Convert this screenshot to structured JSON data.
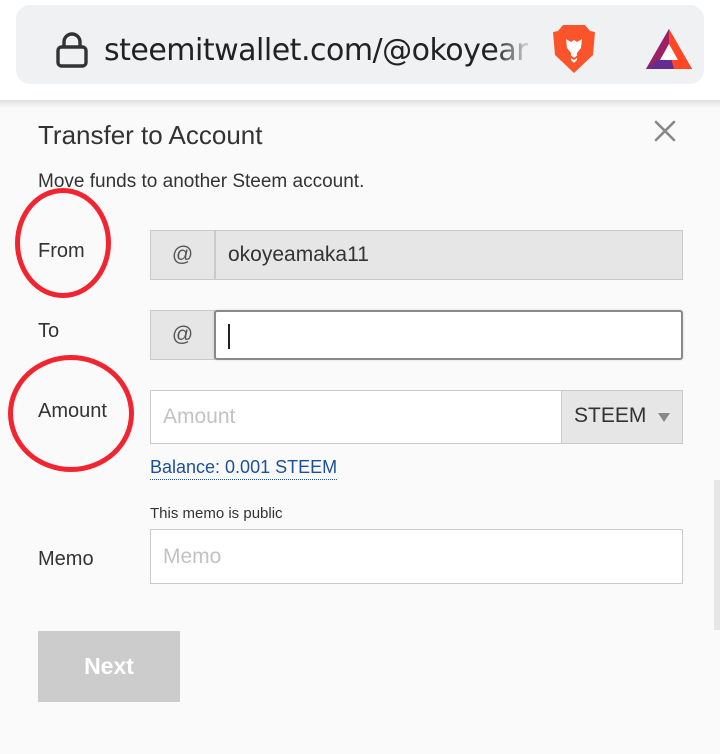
{
  "browser": {
    "url_display": "steemitwallet.com/@okoyeam",
    "icons": [
      "lock-icon",
      "brave-lion-icon",
      "bat-icon"
    ]
  },
  "dialog": {
    "title": "Transfer to Account",
    "subtitle": "Move funds to another Steem account.",
    "close_icon": "close-icon",
    "from": {
      "label": "From",
      "at": "@",
      "value": "okoyeamaka11"
    },
    "to": {
      "label": "To",
      "at": "@",
      "value": ""
    },
    "amount": {
      "label": "Amount",
      "placeholder": "Amount",
      "currency": "STEEM"
    },
    "balance": "Balance: 0.001 STEEM",
    "memo": {
      "label": "Memo",
      "note": "This memo is public",
      "placeholder": "Memo"
    },
    "next_label": "Next"
  },
  "colors": {
    "highlight_circle": "#f2242f",
    "link": "#1a5099",
    "disabled_button": "#cccccc",
    "readonly_bg": "#e6e6e6"
  }
}
